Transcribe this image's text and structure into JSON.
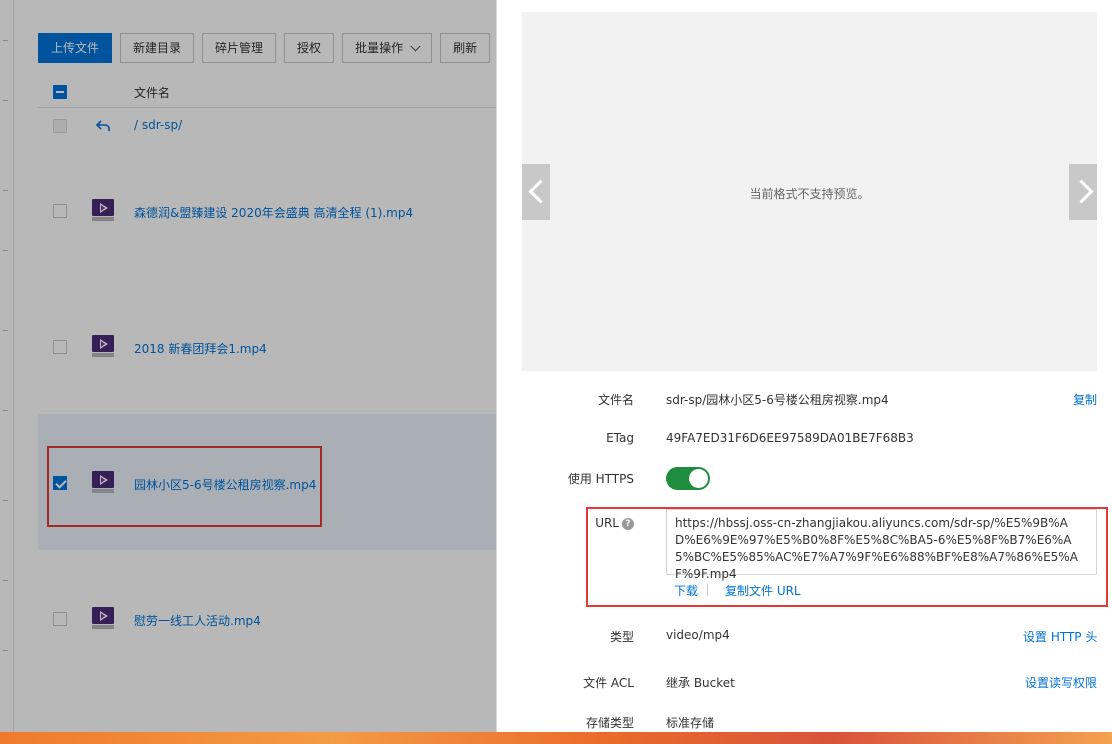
{
  "toolbar": {
    "upload": "上传文件",
    "new_dir": "新建目录",
    "fragments": "碎片管理",
    "authorize": "授权",
    "batch": "批量操作",
    "refresh": "刷新"
  },
  "table": {
    "header_name": "文件名",
    "parent_path": "/ sdr-sp/",
    "files": [
      {
        "name": "森德润&盟臻建设  2020年会盛典  高清全程 (1).mp4",
        "checked": false
      },
      {
        "name": "2018 新春团拜会1.mp4",
        "checked": false
      },
      {
        "name": "园林小区5-6号楼公租房视察.mp4",
        "checked": true
      },
      {
        "name": "慰劳一线工人活动.mp4",
        "checked": false
      }
    ]
  },
  "preview": {
    "message": "当前格式不支持预览。"
  },
  "details": {
    "filename_label": "文件名",
    "filename_value": "sdr-sp/园林小区5-6号楼公租房视察.mp4",
    "copy_link": "复制",
    "etag_label": "ETag",
    "etag_value": "49FA7ED31F6D6EE97589DA01BE7F68B3",
    "https_label": "使用 HTTPS",
    "https_on": true,
    "url_label": "URL",
    "url_help": "?",
    "url_value": "https://hbssj.oss-cn-zhangjiakou.aliyuncs.com/sdr-sp/%E5%9B%AD%E6%9E%97%E5%B0%8F%E5%8C%BA5-6%E5%8F%B7%E6%A5%BC%E5%85%AC%E7%A7%9F%E6%88%BF%E8%A7%86%E5%AF%9F.mp4",
    "download": "下载",
    "copy_url": "复制文件 URL",
    "type_label": "类型",
    "type_value": "video/mp4",
    "set_http_header": "设置 HTTP 头",
    "acl_label": "文件 ACL",
    "acl_value": "继承 Bucket",
    "set_acl": "设置读写权限",
    "storage_label": "存储类型",
    "storage_value": "标准存储"
  },
  "colors": {
    "primary": "#0073d9",
    "toggle_on": "#1e8e3e",
    "highlight": "#e53935",
    "video_icon": "#4a2b78"
  }
}
